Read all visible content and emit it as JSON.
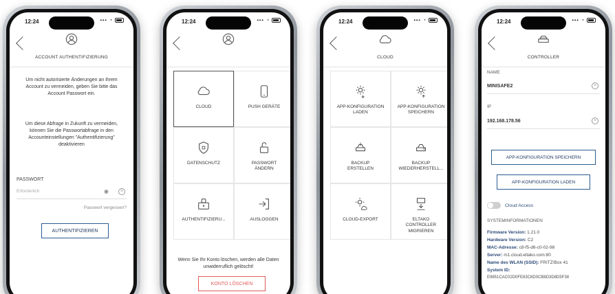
{
  "status": {
    "time": "12:24"
  },
  "screen1": {
    "title": "ACCOUNT AUTHENTIFIZIERUNG",
    "paragraph1": "Um nicht autorisierte Änderungen an ihrem Account zu vermeiden, geben Sie bitte das Account Passwort ein.",
    "paragraph2": "Um diese Abfrage in Zukunft zu vermeiden, können Sie die Passwortabfrage in den Accounteinstellungen \"Authentifizierung\" deaktivieren",
    "password_label": "PASSWORT",
    "password_placeholder": "Erforderlich",
    "forgot_link": "Passwort vergessen?",
    "submit_label": "AUTHENTIFIZIEREN"
  },
  "screen2": {
    "tiles": [
      {
        "label": "CLOUD",
        "icon": "cloud-icon"
      },
      {
        "label": "PUSH GERÄTE",
        "icon": "phone-icon"
      },
      {
        "label": "DATENSCHUTZ",
        "icon": "shield-icon"
      },
      {
        "label": "PASSWORT ÄNDERN",
        "icon": "lock-icon"
      },
      {
        "label": "AUTHENTIFIZIERU...",
        "icon": "device-lock-icon"
      },
      {
        "label": "AUSLOGGEN",
        "icon": "logout-icon"
      }
    ],
    "delete_info": "Wenn Sie Ihr Konto löschen, werden alle Daten unwiderruflich gelöscht!",
    "delete_button": "KONTO LÖSCHEN",
    "accent": "#e05a5a"
  },
  "screen3": {
    "title": "CLOUD",
    "tiles": [
      {
        "label": "APP-KONFIGURATION LADEN",
        "icon": "gear-download-icon"
      },
      {
        "label": "APP-KONFIGURATION SPEICHERN",
        "icon": "gear-upload-icon"
      },
      {
        "label": "BACKUP ERSTELLEN",
        "icon": "backup-create-icon"
      },
      {
        "label": "BACKUP WIEDERHERSTELL...",
        "icon": "backup-restore-icon"
      },
      {
        "label": "CLOUD-EXPORT",
        "icon": "cloud-export-icon"
      },
      {
        "label": "ELTAKO CONTROLLER MIGRIEREN",
        "icon": "controller-migrate-icon"
      }
    ]
  },
  "screen4": {
    "title": "CONTROLLER",
    "name_label": "NAME",
    "name_value": "MINISAFE2",
    "ip_label": "IP",
    "ip_value": "192.168.178.56",
    "save_button": "APP-KONFIGURATION SPEICHERN",
    "load_button": "APP-KONFIGURATION LADEN",
    "cloud_access_label": "Cloud Access",
    "sysinfo_label": "SYSTEMINFORMATIONEN",
    "sysinfo": [
      {
        "key": "Firmware Version:",
        "value": "1.21.0"
      },
      {
        "key": "Hardware Version:",
        "value": "C2"
      },
      {
        "key": "MAC-Adresse:",
        "value": "c8-f5-d6-c0-02-98"
      },
      {
        "key": "Server:",
        "value": "m1.cloud.eltako.com:80"
      },
      {
        "key": "Name des WLAN (SSID):",
        "value": "FRITZ!Box 41"
      },
      {
        "key": "System ID:",
        "value": ""
      },
      {
        "key": "",
        "value": "E9851CAC02D0FE83C8D0CB6D3D8D5F38"
      }
    ]
  },
  "colors": {
    "button_border": "#2a5a90",
    "delete": "#e05a5a"
  }
}
